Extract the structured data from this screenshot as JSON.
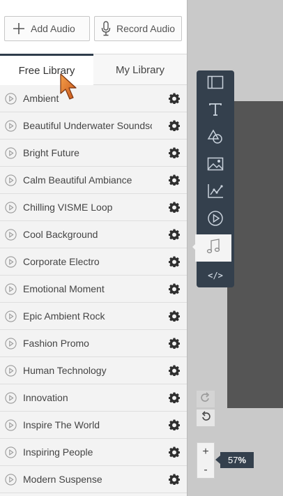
{
  "buttons": {
    "add_audio": "Add Audio",
    "record_audio": "Record Audio"
  },
  "tabs": {
    "free_library": "Free Library",
    "my_library": "My Library",
    "active": "free_library"
  },
  "tracks": [
    "Ambient",
    "Beautiful Underwater Soundscape",
    "Bright Future",
    "Calm Beautiful Ambiance",
    "Chilling VISME Loop",
    "Cool Background",
    "Corporate Electro",
    "Emotional Moment",
    "Epic Ambient Rock",
    "Fashion Promo",
    "Human Technology",
    "Innovation",
    "Inspire The World",
    "Inspiring People",
    "Modern Suspense"
  ],
  "toolbar": {
    "items": [
      "layout-icon",
      "text-icon",
      "shapes-icon",
      "image-icon",
      "chart-icon",
      "video-icon",
      "audio-icon",
      "embed-icon"
    ],
    "active": "audio-icon",
    "embed_label": "</>"
  },
  "zoom": {
    "value": "57",
    "unit": "%",
    "plus": "+",
    "minus": "-"
  },
  "colors": {
    "toolbar_bg": "#34404d",
    "canvas_bg": "#c9c9c9",
    "slide_bg": "#555555",
    "cursor": "#e07a1f"
  }
}
